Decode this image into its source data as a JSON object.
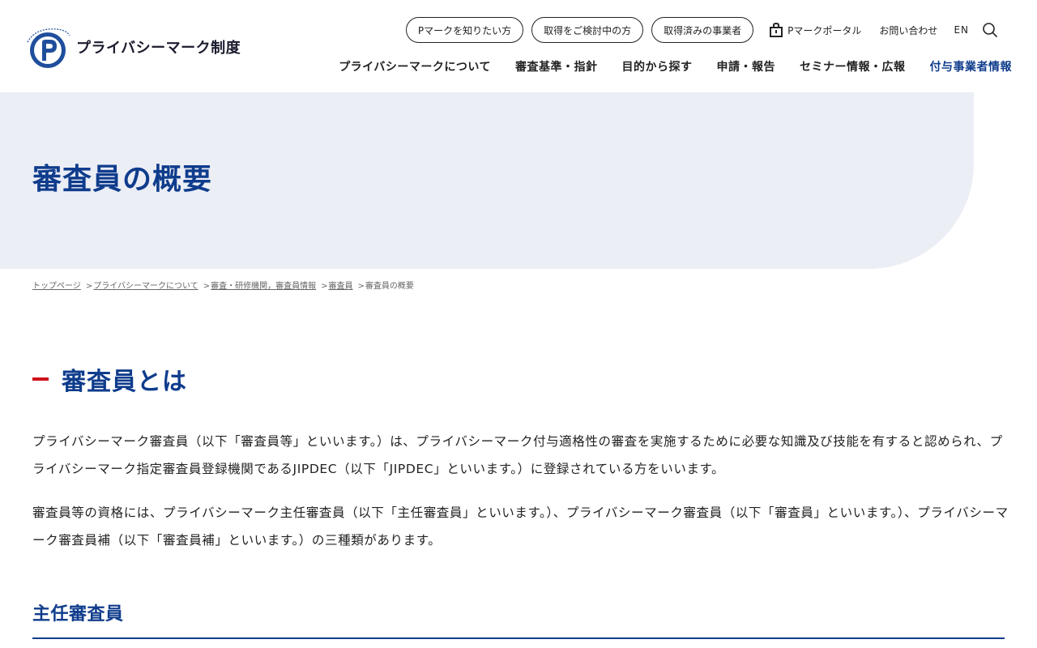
{
  "brand": {
    "logo_arc_text": "たいせつにしますプライバシー",
    "title": "プライバシーマーク制度"
  },
  "utility_nav": {
    "pills": [
      {
        "label": "Pマークを知りたい方"
      },
      {
        "label": "取得をご検討中の方"
      },
      {
        "label": "取得済みの事業者"
      }
    ],
    "portal_label": "Pマークポータル",
    "inquiry_label": "お問い合わせ",
    "lang_label": "EN",
    "search_icon": "search-icon"
  },
  "main_nav": {
    "items": [
      {
        "label": "プライバシーマークについて"
      },
      {
        "label": "審査基準・指針"
      },
      {
        "label": "目的から探す"
      },
      {
        "label": "申請・報告"
      },
      {
        "label": "セミナー情報・広報"
      },
      {
        "label": "付与事業者情報"
      }
    ],
    "active_index": 5
  },
  "hero": {
    "title": "審査員の概要"
  },
  "breadcrumb": {
    "items": [
      {
        "label": "トップページ"
      },
      {
        "label": "プライバシーマークについて"
      },
      {
        "label": "審査・研修機関，審査員情報"
      },
      {
        "label": "審査員"
      }
    ],
    "current": "審査員の概要",
    "separator": ">"
  },
  "content": {
    "heading": "審査員とは",
    "paragraphs": [
      "プライバシーマーク審査員（以下「審査員等」といいます。）は、プライバシーマーク付与適格性の審査を実施するために必要な知識及び技能を有すると認められ、プライバシーマーク指定審査員登録機関であるJIPDEC（以下「JIPDEC」といいます。）に登録されている方をいいます。",
      "審査員等の資格には、プライバシーマーク主任審査員（以下「主任審査員」といいます。）、プライバシーマーク審査員（以下「審査員」といいます。）、プライバシーマーク審査員補（以下「審査員補」といいます。）の三種類があります。"
    ],
    "subheading": "主任審査員"
  },
  "colors": {
    "brand_blue": "#0f3c8c",
    "accent_red": "#d0121b",
    "hero_bg": "#eceef6"
  }
}
